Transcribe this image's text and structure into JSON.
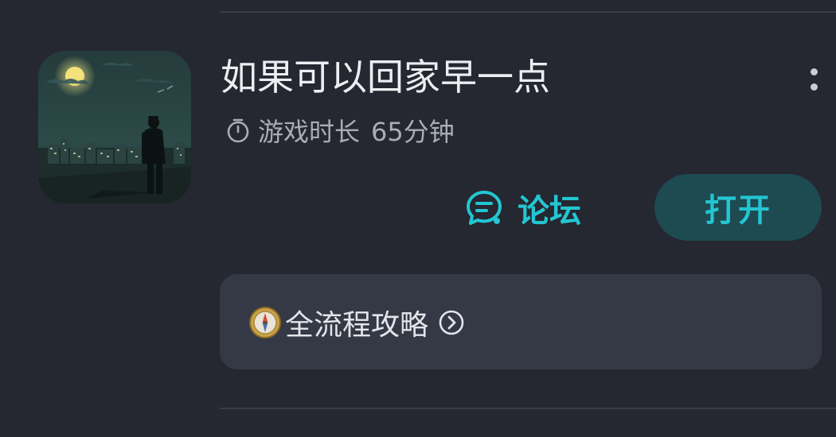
{
  "game": {
    "title": "如果可以回家早一点",
    "playtime_label": "游戏时长",
    "playtime_value": "65分钟",
    "icon_name": "game-cover-image"
  },
  "actions": {
    "forum_label": "论坛",
    "forum_icon": "forum-chat-icon",
    "open_label": "打开",
    "more_icon": "more-vertical-icon"
  },
  "guide": {
    "label": "全流程攻略",
    "leading_icon": "compass-icon",
    "trailing_icon": "chevron-right-circle-icon"
  },
  "colors": {
    "background": "#252731",
    "accent": "#23c6d2",
    "open_button_bg": "#1e4a51",
    "card_bg": "#353946",
    "title_text": "#eceef2",
    "secondary_text": "#a9adb6"
  }
}
